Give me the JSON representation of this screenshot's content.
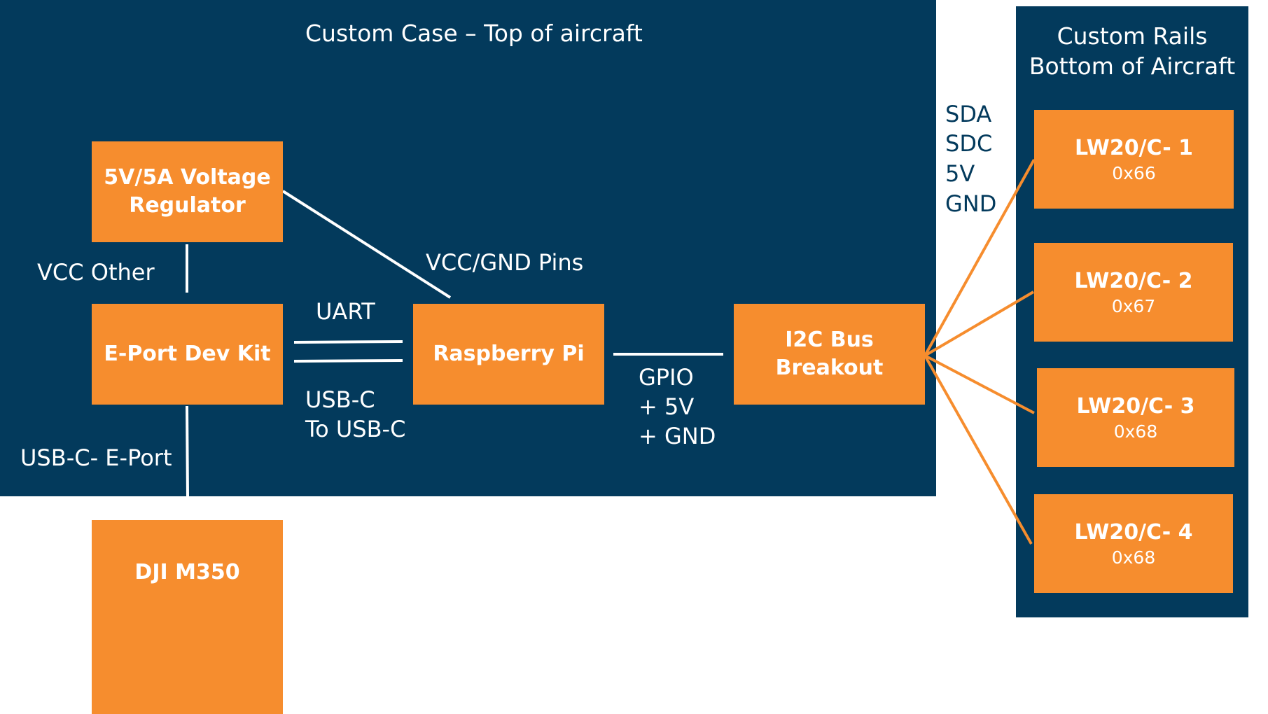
{
  "colors": {
    "panel": "#033A5C",
    "box": "#F68D2E",
    "wire_white": "#ffffff",
    "wire_orange": "#F68D2E"
  },
  "case_panel": {
    "title": "Custom Case – Top of aircraft"
  },
  "rails_panel": {
    "title_line1": "Custom Rails",
    "title_line2": "Bottom of Aircraft"
  },
  "boxes": {
    "regulator": {
      "line1": "5V/5A Voltage",
      "line2": "Regulator"
    },
    "eport": {
      "label": "E-Port Dev Kit"
    },
    "rpi": {
      "label": "Raspberry Pi"
    },
    "i2c": {
      "line1": "I2C Bus",
      "line2": "Breakout"
    },
    "dji": {
      "label": "DJI M350"
    }
  },
  "sensors": [
    {
      "name": "LW20/C- 1",
      "address": "0x66"
    },
    {
      "name": "LW20/C- 2",
      "address": "0x67"
    },
    {
      "name": "LW20/C- 3",
      "address": "0x68"
    },
    {
      "name": "LW20/C- 4",
      "address": "0x68"
    }
  ],
  "labels": {
    "vcc_other": "VCC Other",
    "vcc_gnd_pins": "VCC/GND Pins",
    "uart": "UART",
    "usbc_line1": "USB-C",
    "usbc_line2": "To USB-C",
    "usbc_eport": "USB-C- E-Port",
    "gpio_line1": "GPIO",
    "gpio_line2": "+ 5V",
    "gpio_line3": "+ GND",
    "i2c_signals": [
      "SDA",
      "SDC",
      "5V",
      "GND"
    ]
  }
}
